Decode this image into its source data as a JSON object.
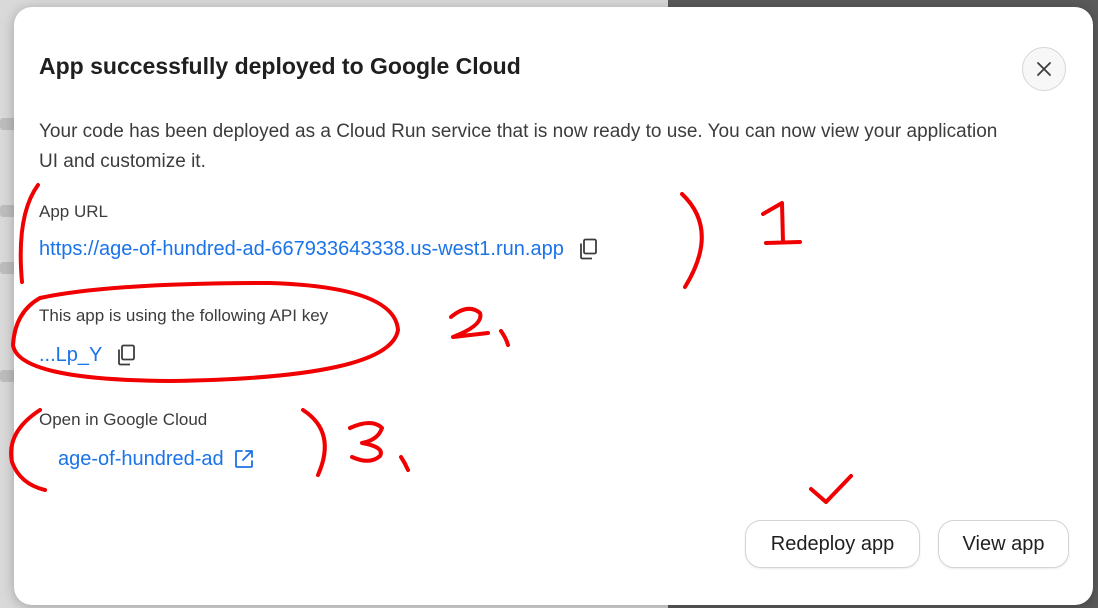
{
  "dialog": {
    "title": "App successfully deployed to Google Cloud",
    "description": "Your code has been deployed as a Cloud Run service that is now ready to use. You can now view your application UI and customize it.",
    "close_icon": "close-icon"
  },
  "app_url": {
    "label": "App URL",
    "value": "https://age-of-hundred-ad-667933643338.us-west1.run.app",
    "icon": "copy-icon"
  },
  "api_key": {
    "label": "This app is using the following API key",
    "value": "...Lp_Y",
    "icon": "copy-icon"
  },
  "google_cloud": {
    "label": "Open in Google Cloud",
    "value": "age-of-hundred-ad",
    "icon": "external-link-icon"
  },
  "actions": {
    "redeploy_label": "Redeploy app",
    "view_label": "View app"
  },
  "annotations": {
    "marks": [
      "1",
      "2,",
      "3,",
      "checkmark"
    ],
    "color": "#f00000"
  },
  "colors": {
    "link": "#1a73e8",
    "title": "#1f1f1f",
    "body_text": "#3c3c3c"
  }
}
